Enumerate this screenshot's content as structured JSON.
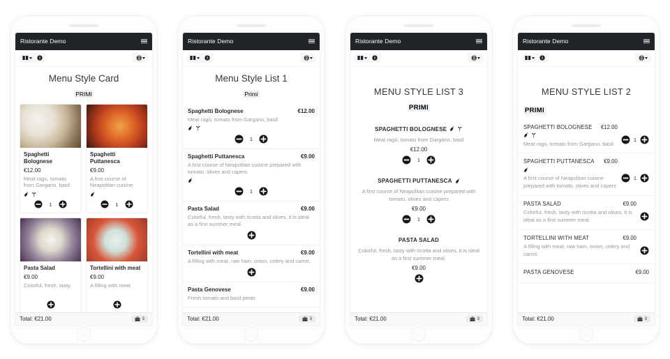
{
  "app": {
    "title": "Ristorante Demo",
    "menu_icon": "hamburger-menu-icon",
    "toolbar": {
      "book_icon": "book-icon",
      "info_icon": "info-circle-icon",
      "language_icon": "globe-icon"
    },
    "total_label": "Total: €21.00",
    "cart_icon": "shopping-bag-icon",
    "cart_count": "3"
  },
  "phones": [
    {
      "id": "menu-style-card",
      "title": "Menu Style Card",
      "category": "PRIMI",
      "layout": "card",
      "items": [
        {
          "name": "Spaghetti Bolognese",
          "price": "€12.00",
          "desc": "Meat ragù, tomato from Gargano, basil",
          "qty": "1",
          "allergens": [
            "chili-icon",
            "wheat-icon"
          ],
          "img": "bolognese"
        },
        {
          "name": "Spaghetti Puttanesca",
          "price": "€9.00",
          "desc": "A first course of Neapolitan cuisine",
          "qty": "1",
          "allergens": [
            "chili-icon"
          ],
          "img": "puttanesca"
        },
        {
          "name": "Pasta Salad",
          "price": "€9.00",
          "desc": "Colorful, fresh, tasty",
          "qty": "",
          "allergens": [],
          "img": "salad"
        },
        {
          "name": "Tortellini with meat",
          "price": "€9.00",
          "desc": "A filling with meat",
          "qty": "",
          "allergens": [],
          "img": "tortellini"
        }
      ]
    },
    {
      "id": "menu-style-list-1",
      "title": "Menu Style List 1",
      "category": "Primi",
      "layout": "list1",
      "items": [
        {
          "name": "Spaghetti Bolognese",
          "price": "€12.00",
          "desc": "Meat ragù, tomato from Gargano, basil",
          "qty": "1",
          "allergens": [
            "chili-icon",
            "wheat-icon"
          ]
        },
        {
          "name": "Spaghetti Puttanesca",
          "price": "€9.00",
          "desc": "A first course of Neapolitan cuisine prepared with tomato, olives and capers",
          "qty": "1",
          "allergens": [
            "chili-icon"
          ]
        },
        {
          "name": "Pasta Salad",
          "price": "€9.00",
          "desc": "Colorful, fresh, tasty with ricotta and olives, it is ideal as a first summer meal.",
          "qty": "",
          "allergens": []
        },
        {
          "name": "Tortellini with meat",
          "price": "€9.00",
          "desc": "A filling with meat, raw ham, onion, celery and carrot.",
          "qty": "",
          "allergens": []
        },
        {
          "name": "Pasta Genovese",
          "price": "€9.00",
          "desc": "Fresh tomato and basil pesto.",
          "qty": "",
          "allergens": []
        }
      ]
    },
    {
      "id": "menu-style-list-3",
      "title": "MENU STYLE LIST 3",
      "category": "PRIMI",
      "layout": "list3",
      "items": [
        {
          "name": "SPAGHETTI BOLOGNESE",
          "price": "€12.00",
          "desc": "Meat ragù, tomato from Gargano, basil",
          "qty": "1",
          "allergens": [
            "chili-icon",
            "wheat-icon"
          ]
        },
        {
          "name": "SPAGHETTI PUTTANESCA",
          "price": "€9.00",
          "desc": "A first course of Neapolitan cuisine prepared with tomato, olives and capers",
          "qty": "1",
          "allergens": [
            "chili-icon"
          ]
        },
        {
          "name": "PASTA SALAD",
          "price": "€9.00",
          "desc": "Colorful, fresh, tasty with ricotta and olives, it is ideal as a first summer meal.",
          "qty": "",
          "allergens": []
        }
      ]
    },
    {
      "id": "menu-style-list-2",
      "title": "MENU STYLE LIST 2",
      "category": "PRIMI",
      "layout": "list2",
      "items": [
        {
          "name": "SPAGHETTI BOLOGNESE",
          "price": "€12.00",
          "desc": "Meat ragù, tomato from Gargano, basil",
          "qty": "1",
          "allergens": [
            "chili-icon",
            "wheat-icon"
          ]
        },
        {
          "name": "SPAGHETTI PUTTANESCA",
          "price": "€9.00",
          "desc": "A first course of Neapolitan cuisine prepared with tomato, olives and capers",
          "qty": "1",
          "allergens": [
            "chili-icon"
          ]
        },
        {
          "name": "PASTA SALAD",
          "price": "€9.00",
          "desc": "Colorful, fresh, tasty with ricotta and olives, it is ideal as a first summer meal.",
          "qty": "",
          "allergens": []
        },
        {
          "name": "TORTELLINI WITH MEAT",
          "price": "€9.00",
          "desc": "A filling with meat, raw ham, onion, celery and carrot.",
          "qty": "",
          "allergens": []
        },
        {
          "name": "PASTA GENOVESE",
          "price": "€9.00",
          "desc": "",
          "qty": "",
          "allergens": []
        }
      ]
    }
  ],
  "colors": {
    "appbar": "#212529",
    "text": "#26292d",
    "muted": "#9298a0",
    "category_bg": "#eef1f4"
  }
}
